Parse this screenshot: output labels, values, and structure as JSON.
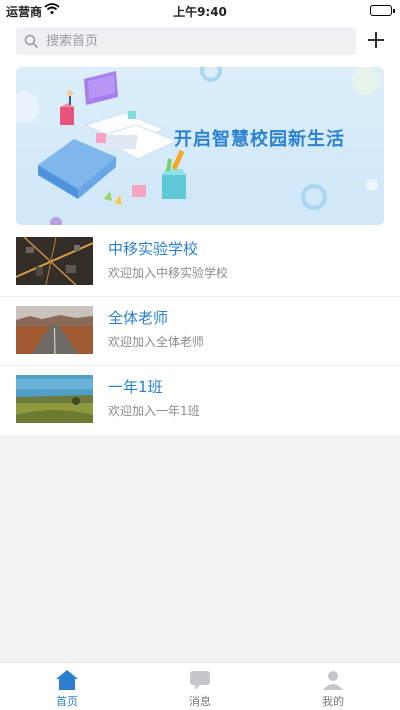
{
  "status_bar": {
    "carrier": "运营商",
    "time": "上午9:40"
  },
  "search": {
    "placeholder": "搜索首页"
  },
  "banner": {
    "title": "开启智慧校园新生活"
  },
  "groups": [
    {
      "name": "中移实验学校",
      "subtitle": "欢迎加入中移实验学校"
    },
    {
      "name": "全体老师",
      "subtitle": "欢迎加入全体老师"
    },
    {
      "name": "一年1班",
      "subtitle": "欢迎加入一年1班"
    }
  ],
  "tabbar": [
    {
      "label": "首页",
      "icon": "home-icon",
      "active": true
    },
    {
      "label": "消息",
      "icon": "message-icon",
      "active": false
    },
    {
      "label": "我的",
      "icon": "profile-icon",
      "active": false
    }
  ],
  "colors": {
    "accent": "#2a7fd0",
    "banner_bg": "#d6ebfa",
    "page_bg": "#f2f3f7"
  }
}
